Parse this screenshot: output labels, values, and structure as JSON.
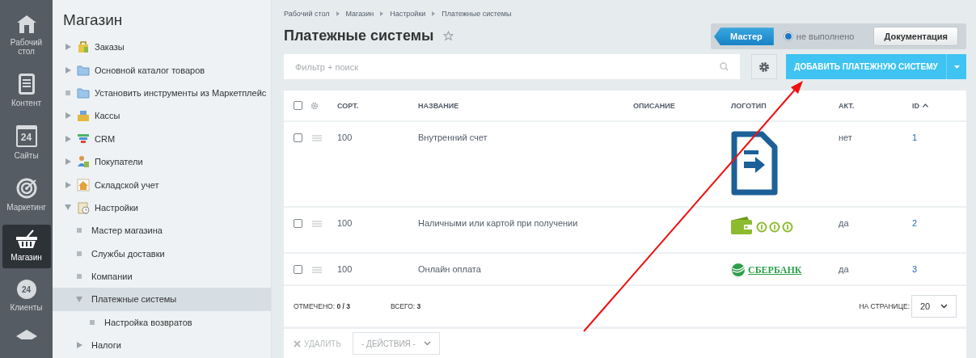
{
  "rail": [
    {
      "label": "Рабочий стол",
      "kind": "home",
      "selected": false
    },
    {
      "label": "Контент",
      "kind": "document",
      "selected": false
    },
    {
      "label": "Сайты",
      "kind": "calendar",
      "badge": "24",
      "selected": false
    },
    {
      "label": "Маркетинг",
      "kind": "target",
      "selected": false
    },
    {
      "label": "Магазин",
      "kind": "basket",
      "selected": true
    },
    {
      "label": "Клиенты",
      "kind": "cloud",
      "badge": "24",
      "selected": false
    },
    {
      "kind": "stack",
      "selected": false
    }
  ],
  "sidebar": {
    "title": "Магазин",
    "items": [
      {
        "label": "Заказы",
        "kind": "branch",
        "expanded": false,
        "selected": false
      },
      {
        "label": "Основной каталог товаров",
        "kind": "branch",
        "expanded": false,
        "selected": false
      },
      {
        "label": "Установить инструменты из Маркетплейс",
        "kind": "leaf",
        "selected": false
      },
      {
        "label": "Кассы",
        "kind": "branch",
        "expanded": false,
        "selected": false
      },
      {
        "label": "CRM",
        "kind": "branch",
        "expanded": false,
        "selected": false
      },
      {
        "label": "Покупатели",
        "kind": "branch",
        "expanded": false,
        "selected": false
      },
      {
        "label": "Складской учет",
        "kind": "branch",
        "expanded": false,
        "selected": false
      },
      {
        "label": "Настройки",
        "kind": "branch",
        "expanded": true,
        "selected": false,
        "children": [
          {
            "label": "Мастер магазина",
            "kind": "leaf",
            "selected": false
          },
          {
            "label": "Службы доставки",
            "kind": "leaf",
            "selected": false
          },
          {
            "label": "Компании",
            "kind": "leaf",
            "selected": false
          },
          {
            "label": "Платежные системы",
            "kind": "branch",
            "expanded": true,
            "selected": true,
            "children": [
              {
                "label": "Настройка возвратов",
                "kind": "leaf",
                "selected": false
              }
            ]
          },
          {
            "label": "Налоги",
            "kind": "branch",
            "expanded": false,
            "selected": false
          }
        ]
      }
    ]
  },
  "breadcrumbs": [
    "Рабочий стол",
    "Магазин",
    "Настройки",
    "Платежные системы"
  ],
  "title": "Платежные системы",
  "favorite": false,
  "master": {
    "button": "Мастер",
    "status": "не выполнено",
    "status_checked": true,
    "docs": "Документация"
  },
  "filter": {
    "placeholder": "Фильтр + поиск"
  },
  "add_button": "ДОБАВИТЬ ПЛАТЕЖНУЮ СИСТЕМУ",
  "table": {
    "all_checked": false,
    "columns": [
      {
        "label": "СОРТ.",
        "sorted": false
      },
      {
        "label": "НАЗВАНИЕ",
        "sorted": false
      },
      {
        "label": "ОПИСАНИЕ",
        "sorted": false
      },
      {
        "label": "ЛОГОТИП",
        "sorted": false
      },
      {
        "label": "АКТ.",
        "sorted": false
      },
      {
        "label": "ID",
        "sorted": true
      }
    ],
    "rows": [
      {
        "checked": false,
        "sort": "100",
        "name": "Внутренний счет",
        "logo": {
          "kind": "document"
        },
        "active": "нет",
        "id": "1"
      },
      {
        "checked": false,
        "sort": "100",
        "name": "Наличными или картой при получении",
        "logo": {
          "kind": "wallet"
        },
        "active": "да",
        "id": "2"
      },
      {
        "checked": false,
        "sort": "100",
        "name": "Онлайн оплата",
        "logo": {
          "kind": "bank",
          "text": "СБЕРБАНК"
        },
        "active": "да",
        "id": "3"
      }
    ],
    "selected_count": "ОТМЕЧЕНО: **0 / 3**",
    "total": "ВСЕГО: **3**",
    "per_page_label": "НА СТРАНИЦЕ:",
    "per_page": "20",
    "delete": {
      "label": "УДАЛИТЬ",
      "disabled": true
    },
    "actions": "- ДЕЙСТВИЯ -"
  },
  "overlay": {
    "kind": "arrow"
  }
}
